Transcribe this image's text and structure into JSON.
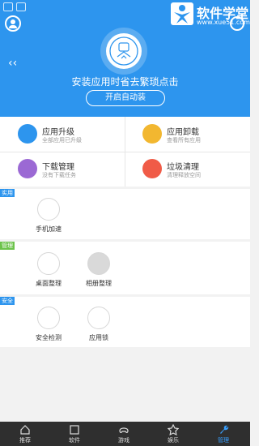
{
  "header": {
    "title": "安装应用时省去繁琐点击",
    "button": "开启自动装",
    "logo_text": "软件学堂",
    "logo_site": "www.xue51.com",
    "back_icon": "‹‹"
  },
  "cards": [
    {
      "name": "应用升级",
      "sub": "全部应用已升级",
      "color": "#2d95ee",
      "icon": "upgrade-icon"
    },
    {
      "name": "应用卸载",
      "sub": "查看所有应用",
      "color": "#f2b730",
      "icon": "trash-icon"
    },
    {
      "name": "下载管理",
      "sub": "没有下载任务",
      "color": "#9b69d4",
      "icon": "download-icon"
    },
    {
      "name": "垃圾清理",
      "sub": "清理释放空间",
      "color": "#f05b47",
      "icon": "broom-icon"
    }
  ],
  "sections": [
    {
      "tag": "实用",
      "tag_color": "#2d95ee",
      "tools": [
        {
          "label": "手机加速",
          "icon": "speed-icon"
        }
      ]
    },
    {
      "tag": "管理",
      "tag_color": "#6cc34b",
      "tools": [
        {
          "label": "桌面整理",
          "icon": "desktop-icon"
        },
        {
          "label": "相册整理",
          "icon": "photo-icon"
        }
      ]
    },
    {
      "tag": "安全",
      "tag_color": "#2d95ee",
      "tools": [
        {
          "label": "安全检测",
          "icon": "shield-icon"
        },
        {
          "label": "应用锁",
          "icon": "lock-icon"
        }
      ]
    }
  ],
  "tabs": [
    {
      "label": "推荐",
      "icon": "home-icon"
    },
    {
      "label": "软件",
      "icon": "software-icon"
    },
    {
      "label": "游戏",
      "icon": "gamepad-icon"
    },
    {
      "label": "娱乐",
      "icon": "star-icon"
    },
    {
      "label": "管理",
      "icon": "wrench-icon",
      "active": true
    }
  ]
}
